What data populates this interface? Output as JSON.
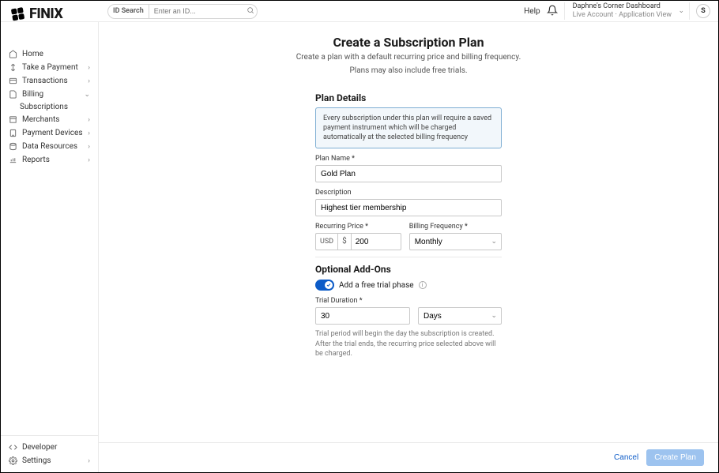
{
  "topbar": {
    "search_tag": "ID Search",
    "search_placeholder": "Enter an ID...",
    "help": "Help",
    "account_name": "Daphne's Corner Dashboard",
    "account_sub": "Live Account  ·  Application View",
    "avatar_initial": "S"
  },
  "logo_text": "FINIX",
  "nav": {
    "home": "Home",
    "take_payment": "Take a Payment",
    "transactions": "Transactions",
    "billing": "Billing",
    "subscriptions": "Subscriptions",
    "merchants": "Merchants",
    "payment_devices": "Payment Devices",
    "data_resources": "Data Resources",
    "reports": "Reports",
    "developer": "Developer",
    "settings": "Settings"
  },
  "page": {
    "title": "Create a Subscription Plan",
    "sub1": "Create a plan with a default recurring price and billing frequency.",
    "sub2": "Plans may also include free trials."
  },
  "plan_details": {
    "heading": "Plan Details",
    "info": "Every subscription under this plan will require a saved payment instrument which will be charged automatically at the selected billing frequency",
    "name_label": "Plan Name *",
    "name_value": "Gold Plan",
    "desc_label": "Description",
    "desc_value": "Highest tier membership",
    "price_label": "Recurring Price *",
    "currency": "USD",
    "symbol": "$",
    "price_value": "200",
    "freq_label": "Billing Frequency *",
    "freq_value": "Monthly"
  },
  "addons": {
    "heading": "Optional Add-Ons",
    "toggle_label": "Add a free trial phase",
    "duration_label": "Trial Duration *",
    "duration_value": "30",
    "unit_value": "Days",
    "helper": "Trial period will begin the day the subscription is created. After the trial ends, the recurring price selected above will be charged."
  },
  "footer": {
    "cancel": "Cancel",
    "create": "Create Plan"
  }
}
